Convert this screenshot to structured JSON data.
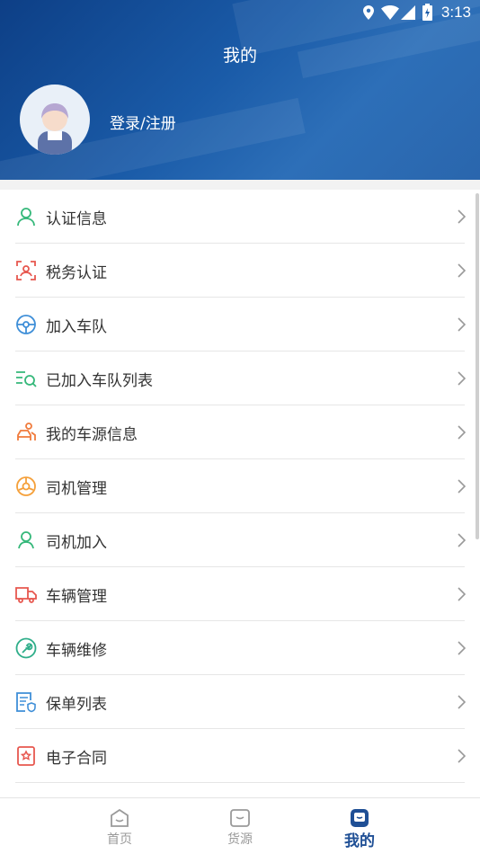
{
  "status": {
    "time": "3:13"
  },
  "header": {
    "title": "我的",
    "login": "登录/注册"
  },
  "menu": [
    {
      "label": "认证信息"
    },
    {
      "label": "税务认证"
    },
    {
      "label": "加入车队"
    },
    {
      "label": "已加入车队列表"
    },
    {
      "label": "我的车源信息"
    },
    {
      "label": "司机管理"
    },
    {
      "label": "司机加入"
    },
    {
      "label": "车辆管理"
    },
    {
      "label": "车辆维修"
    },
    {
      "label": "保单列表"
    },
    {
      "label": "电子合同"
    }
  ],
  "tabs": [
    {
      "label": "首页"
    },
    {
      "label": "货源"
    },
    {
      "label": "我的"
    }
  ],
  "colors": {
    "header": "#1a5ba8",
    "accent": "#1f4f95"
  }
}
